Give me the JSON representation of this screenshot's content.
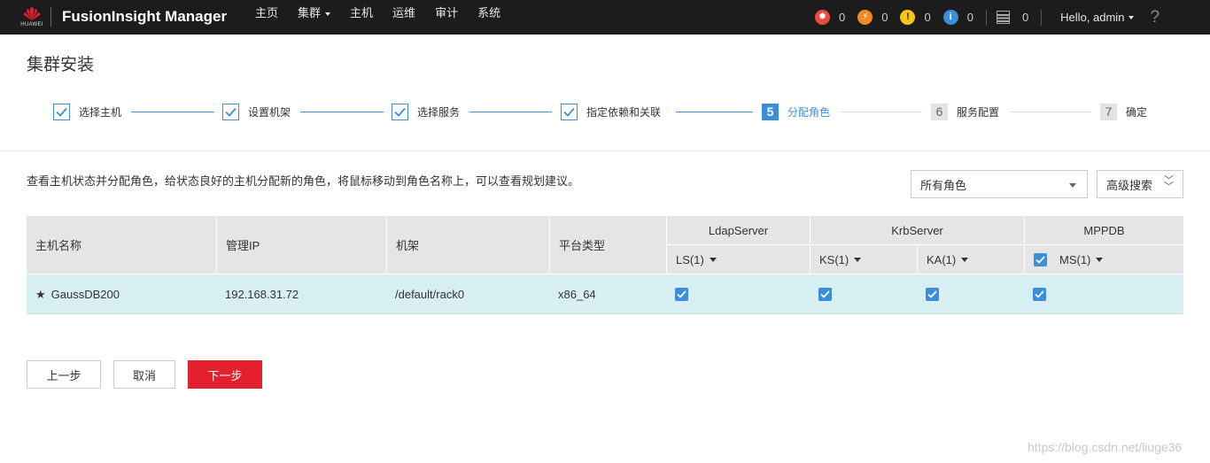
{
  "brand": {
    "logo_text": "HUAWEI",
    "app_title": "FusionInsight Manager"
  },
  "nav": [
    "主页",
    "集群",
    "主机",
    "运维",
    "审计",
    "系统"
  ],
  "alarms": [
    {
      "icon": "critical-fire-icon",
      "glyph": "✹",
      "color": "#e84c3d",
      "count": "0"
    },
    {
      "icon": "major-bolt-icon",
      "glyph": "⚡",
      "color": "#f08a24",
      "count": "0"
    },
    {
      "icon": "minor-warning-icon",
      "glyph": "!",
      "color": "#f5c518",
      "count": "0"
    },
    {
      "icon": "info-icon",
      "glyph": "i",
      "color": "#3b8ed8",
      "count": "0"
    }
  ],
  "tasks_count": "0",
  "user": "Hello, admin",
  "help": "?",
  "page_title": "集群安装",
  "steps": [
    {
      "num": "1",
      "label": "选择主机",
      "status": "done"
    },
    {
      "num": "2",
      "label": "设置机架",
      "status": "done"
    },
    {
      "num": "3",
      "label": "选择服务",
      "status": "done"
    },
    {
      "num": "4",
      "label": "指定依赖和关联",
      "status": "done"
    },
    {
      "num": "5",
      "label": "分配角色",
      "status": "current"
    },
    {
      "num": "6",
      "label": "服务配置",
      "status": "todo"
    },
    {
      "num": "7",
      "label": "确定",
      "status": "todo"
    }
  ],
  "hint": "查看主机状态并分配角色，给状态良好的主机分配新的角色，将鼠标移动到角色名称上，可以查看规划建议。",
  "role_filter": "所有角色",
  "advanced_search": "高级搜索",
  "table": {
    "headers": {
      "host": "主机名称",
      "ip": "管理IP",
      "rack": "机架",
      "platform": "平台类型"
    },
    "services": [
      {
        "name": "LdapServer",
        "roles": [
          "LS(1)"
        ]
      },
      {
        "name": "KrbServer",
        "roles": [
          "KS(1)",
          "KA(1)"
        ]
      },
      {
        "name": "MPPDB",
        "roles": [
          "MS(1)"
        ]
      }
    ],
    "rows": [
      {
        "star": "★",
        "host": "GaussDB200",
        "ip": "192.168.31.72",
        "rack": "/default/rack0",
        "platform": "x86_64",
        "checked": [
          true,
          true,
          true,
          true
        ]
      }
    ]
  },
  "buttons": {
    "prev": "上一步",
    "cancel": "取消",
    "next": "下一步"
  },
  "watermark": "https://blog.csdn.net/liuge36"
}
